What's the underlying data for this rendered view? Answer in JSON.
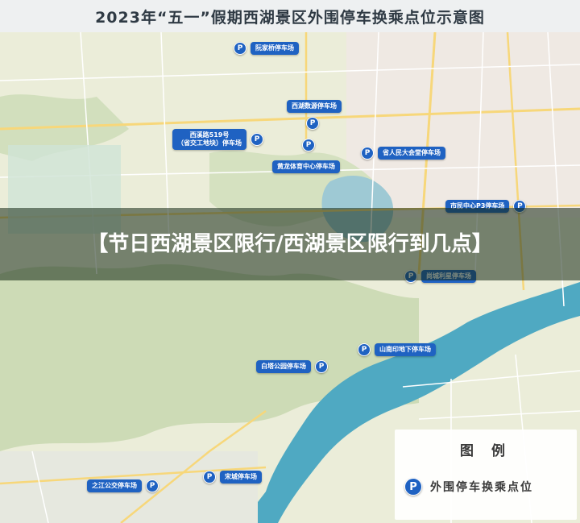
{
  "title": "2023年“五一”假期西湖景区外围停车换乘点位示意图",
  "banner_text": "【节日西湖景区限行/西湖景区限行到几点】",
  "legend": {
    "title": "图 例",
    "item_icon": "P",
    "item_label": "外围停车换乘点位"
  },
  "colors": {
    "marker": "#1f62c2",
    "water": "#4fa9c2",
    "land": "#e9ecd8",
    "forest": "#c9d9b1"
  },
  "icon_names": [
    "parking-icon"
  ],
  "parking_points": [
    {
      "id": "ruanjiaqiao",
      "label": "阮家桥停车场",
      "icon": "P"
    },
    {
      "id": "xihushuyuan",
      "label": "西湖数源停车场",
      "icon": "P"
    },
    {
      "id": "xixilu",
      "label_line1": "西溪路519号",
      "label_line2": "（省交工地块）停车场",
      "icon": "P"
    },
    {
      "id": "shengrenmin",
      "label": "省人民大会堂停车场",
      "icon": "P"
    },
    {
      "id": "huanglong",
      "label": "黄龙体育中心停车场",
      "icon": "P"
    },
    {
      "id": "shimin",
      "label": "市民中心P3停车场",
      "icon": "P"
    },
    {
      "id": "shangcheng",
      "label": "尚城利星停车场",
      "icon": "P"
    },
    {
      "id": "shannan",
      "label": "山南印地下停车场",
      "icon": "P"
    },
    {
      "id": "baita",
      "label": "白塔公园停车场",
      "icon": "P"
    },
    {
      "id": "songcheng",
      "label": "宋城停车场",
      "icon": "P"
    },
    {
      "id": "zhijiang",
      "label": "之江公交停车场",
      "icon": "P"
    }
  ]
}
